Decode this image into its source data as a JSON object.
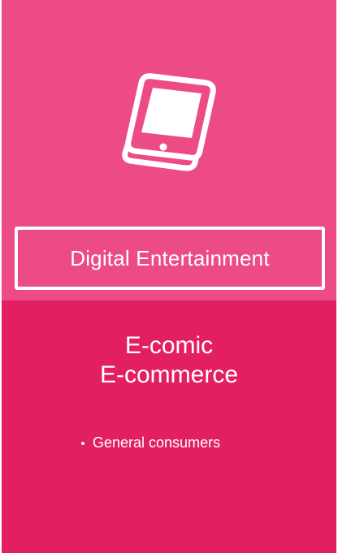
{
  "segment": {
    "icon": "smartphone-icon",
    "title": "Digital Entertainment",
    "products": [
      "E-comic",
      "E-commerce"
    ],
    "customers": [
      "General consumers"
    ]
  },
  "colors": {
    "top_background": "#ec4b86",
    "bottom_background": "#e31f63",
    "foreground": "#ffffff"
  }
}
